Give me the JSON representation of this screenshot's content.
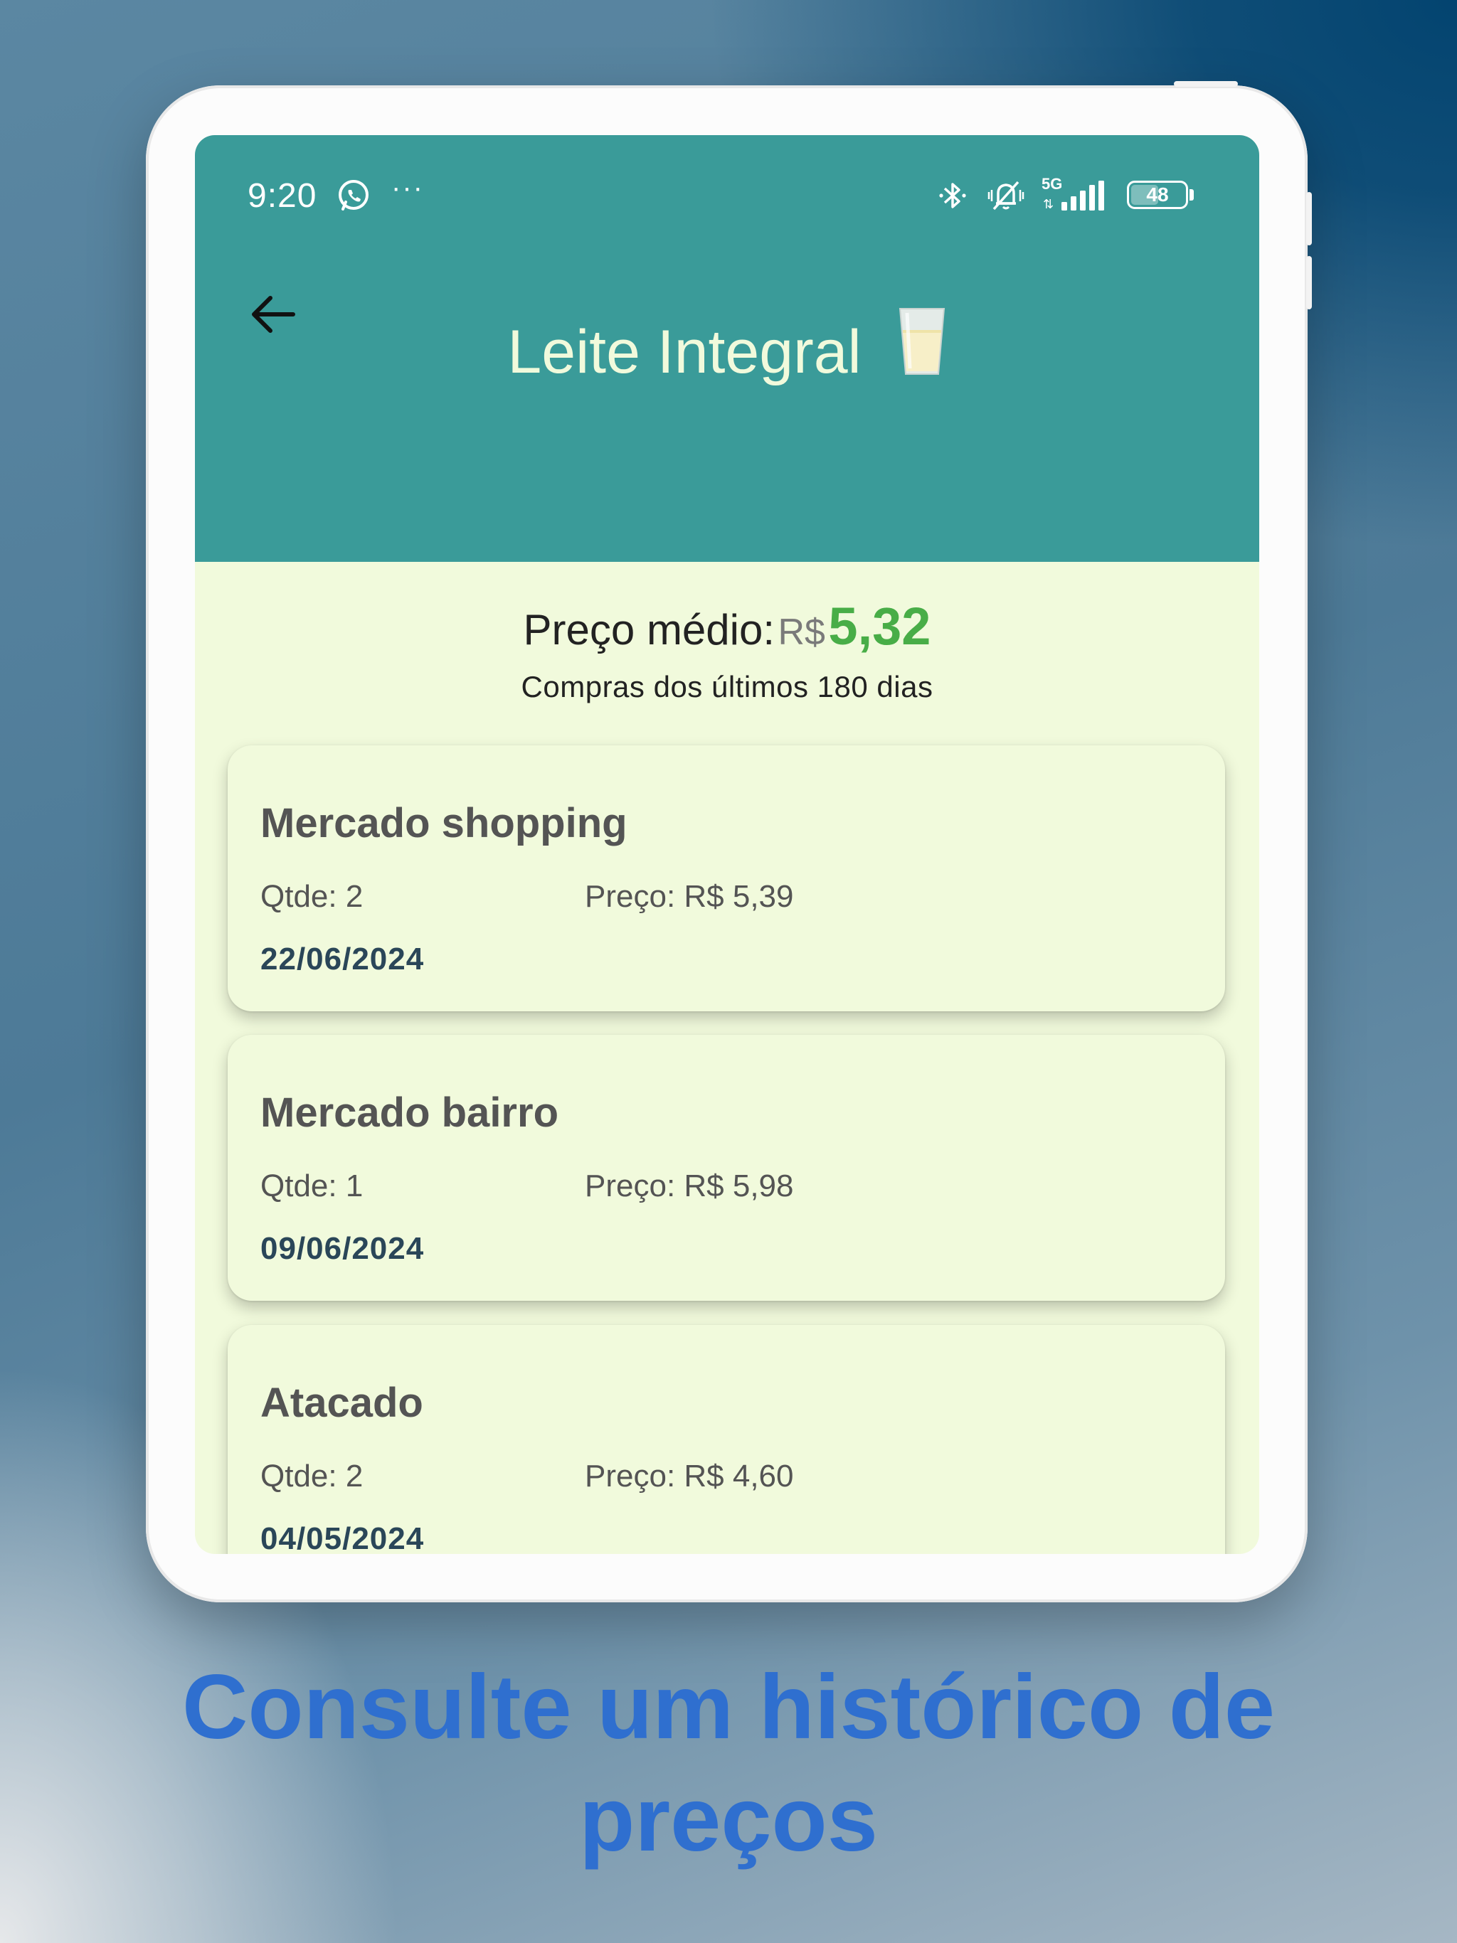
{
  "status_bar": {
    "time": "9:20",
    "network": "5G",
    "battery": "48"
  },
  "header": {
    "title": "Leite Integral",
    "back_icon": "arrow-left-icon",
    "title_icon": "milk-glass-icon",
    "background": "#3a9b99"
  },
  "summary": {
    "label": "Preço médio:",
    "currency": "R$",
    "value": "5,32",
    "subtitle": "Compras dos últimos 180 dias",
    "value_color": "#48ad47"
  },
  "purchases": [
    {
      "store": "Mercado shopping",
      "qty": "Qtde: 2",
      "price": "Preço: R$ 5,39",
      "date": "22/06/2024"
    },
    {
      "store": "Mercado bairro",
      "qty": "Qtde: 1",
      "price": "Preço: R$ 5,98",
      "date": "09/06/2024"
    },
    {
      "store": "Atacado",
      "qty": "Qtde: 2",
      "price": "Preço: R$ 4,60",
      "date": "04/05/2024"
    }
  ],
  "caption": {
    "line1": "Consulte um histórico de",
    "line2": "preços",
    "color": "#2f6fcf"
  }
}
